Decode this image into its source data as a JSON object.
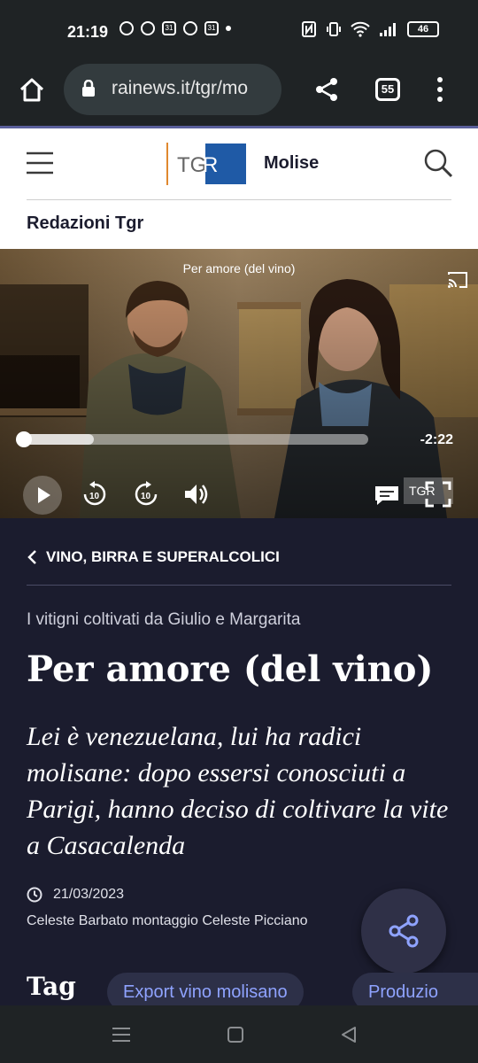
{
  "status_bar": {
    "time": "21:19",
    "calendar_day": "31",
    "battery": "46"
  },
  "browser": {
    "url": "rainews.it/tgr/mo",
    "tab_count": "55"
  },
  "site_header": {
    "logo_text": "TGR",
    "region": "Molise",
    "section": "Redazioni Tgr"
  },
  "video": {
    "title": "Per amore (del vino)",
    "time_remaining": "-2:22",
    "progress": 0.2,
    "watermark": "TGR"
  },
  "article": {
    "category": "VINO, BIRRA E SUPERALCOLICI",
    "kicker": "I vitigni coltivati da Giulio e Margarita",
    "headline": "Per amore (del vino)",
    "subtitle": "Lei è venezuelana, lui ha radici molisane: dopo essersi conosciuti a Parigi, hanno deciso di coltivare la vite a Casacalenda",
    "date": "21/03/2023",
    "authors": "Celeste Barbato montaggio Celeste Picciano"
  },
  "tags": {
    "label": "Tag",
    "items": [
      "Export vino molisano",
      "Produzio"
    ]
  },
  "colors": {
    "page_bg": "#1b1c2e",
    "tag_text": "#8fa3ff",
    "logo_blue": "#1f5aa6",
    "logo_orange": "#e0882f"
  }
}
